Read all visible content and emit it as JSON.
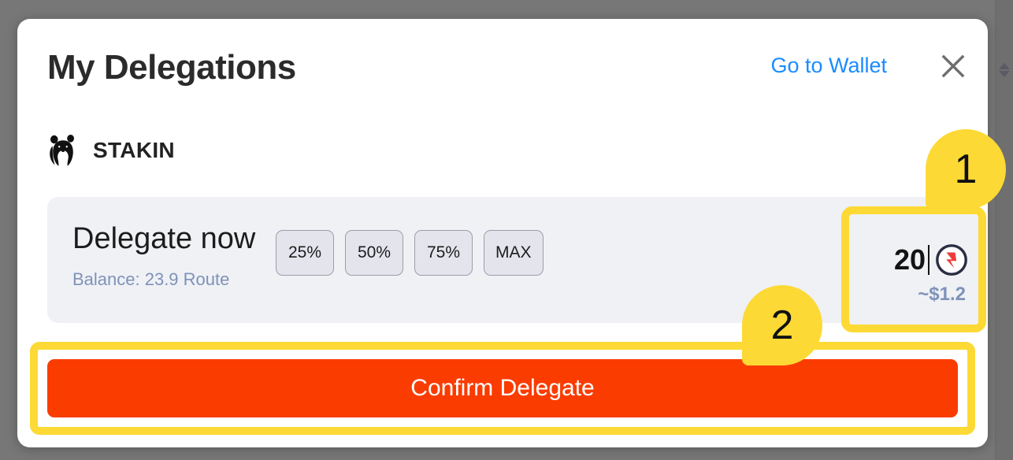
{
  "window": {
    "backdrop_color": "#777777",
    "scrollbar": {
      "up_arrow_icon": "triangle-up-icon",
      "down_arrow_icon": "triangle-down-icon"
    }
  },
  "modal": {
    "title": "My Delegations",
    "go_to_wallet_label": "Go to Wallet",
    "close_icon": "close-icon",
    "accent_link_color": "#1a8cff"
  },
  "validator": {
    "logo_icon": "panda-logo-icon",
    "name": "STAKIN"
  },
  "delegate_panel": {
    "heading": "Delegate now",
    "balance_label": "Balance: 23.9 Route",
    "percent_buttons": [
      {
        "label": "25%"
      },
      {
        "label": "50%"
      },
      {
        "label": "75%"
      },
      {
        "label": "MAX"
      }
    ],
    "amount_input": {
      "value": "20",
      "placeholder": "0",
      "token_icon": "route-token-icon",
      "usd_estimate": "~$1.2",
      "highlight_color": "#fdd935"
    },
    "panel_background": "#eff1f5"
  },
  "confirm": {
    "label": "Confirm Delegate",
    "button_color": "#fa3c00",
    "highlight_color": "#fdd935"
  },
  "annotations": [
    {
      "label": "1"
    },
    {
      "label": "2"
    }
  ]
}
